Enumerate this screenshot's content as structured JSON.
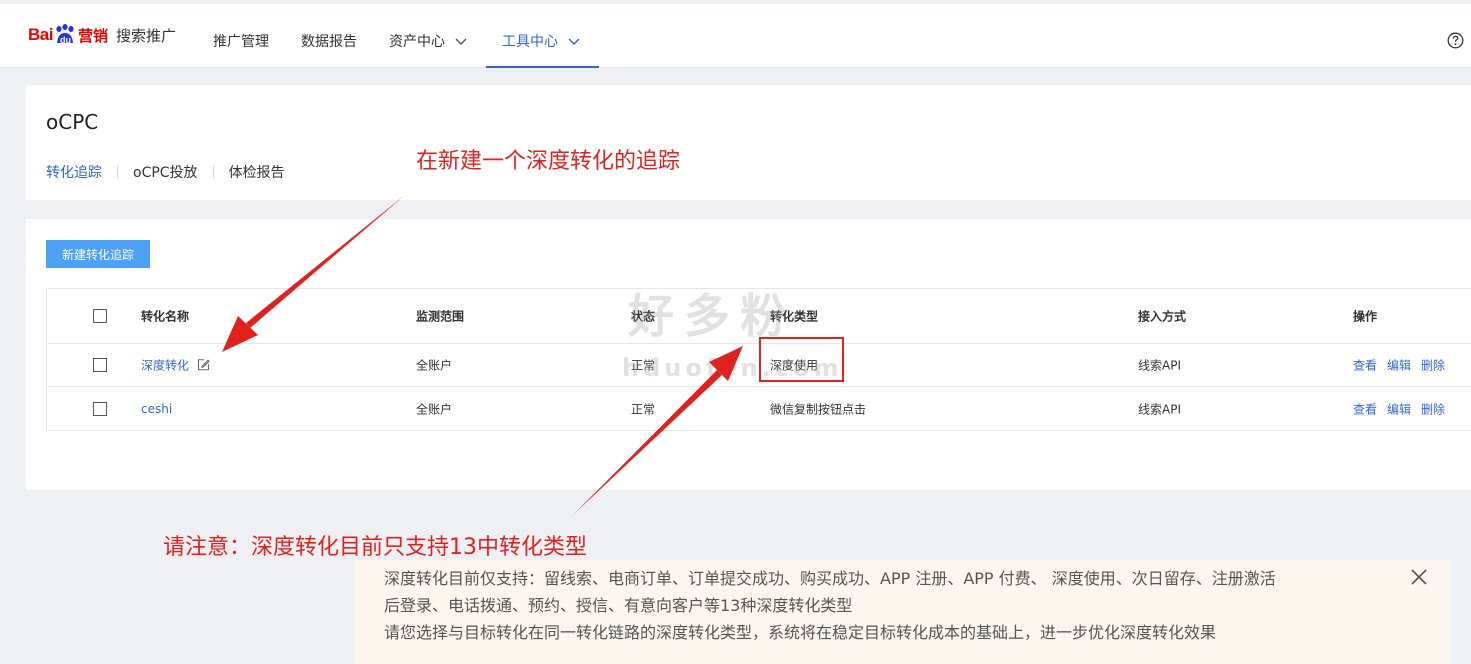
{
  "header": {
    "logo": {
      "bai": "Bai",
      "du": "du",
      "ying": "营销"
    },
    "product": "搜索推广",
    "nav": [
      {
        "label": "推广管理"
      },
      {
        "label": "数据报告"
      },
      {
        "label": "资产中心"
      },
      {
        "label": "工具中心"
      }
    ]
  },
  "page": {
    "title": "oCPC",
    "tabs": [
      "转化追踪",
      "oCPC投放",
      "体检报告"
    ]
  },
  "toolbar": {
    "new_button": "新建转化追踪"
  },
  "table": {
    "headers": [
      "转化名称",
      "监测范围",
      "状态",
      "转化类型",
      "接入方式",
      "操作"
    ],
    "rows": [
      {
        "name": "深度转化",
        "scope": "全账户",
        "status": "正常",
        "type": "深度使用",
        "access": "线索API",
        "ops": [
          "查看",
          "编辑",
          "删除"
        ]
      },
      {
        "name": "ceshi",
        "scope": "全账户",
        "status": "正常",
        "type": "微信复制按钮点击",
        "access": "线索API",
        "ops": [
          "查看",
          "编辑",
          "删除"
        ]
      }
    ]
  },
  "annotations": {
    "top": "在新建一个深度转化的追踪",
    "bottom": "请注意：深度转化目前只支持13中转化类型"
  },
  "watermark": {
    "cn": "好多粉",
    "en": "hduofen.com"
  },
  "notice": {
    "line1": "深度转化目前仅支持：留线索、电商订单、订单提交成功、购买成功、APP 注册、APP 付费、 深度使用、次日留存、注册激活",
    "line2": "后登录、电话拨通、预约、授信、有意向客户等13种深度转化类型",
    "line3": "请您选择与目标转化在同一转化链路的深度转化类型，系统将在稳定目标转化成本的基础上，进一步优化深度转化效果"
  },
  "colors": {
    "accent": "#3366cc",
    "annotation": "#e0221e",
    "button": "#4da1f5"
  }
}
